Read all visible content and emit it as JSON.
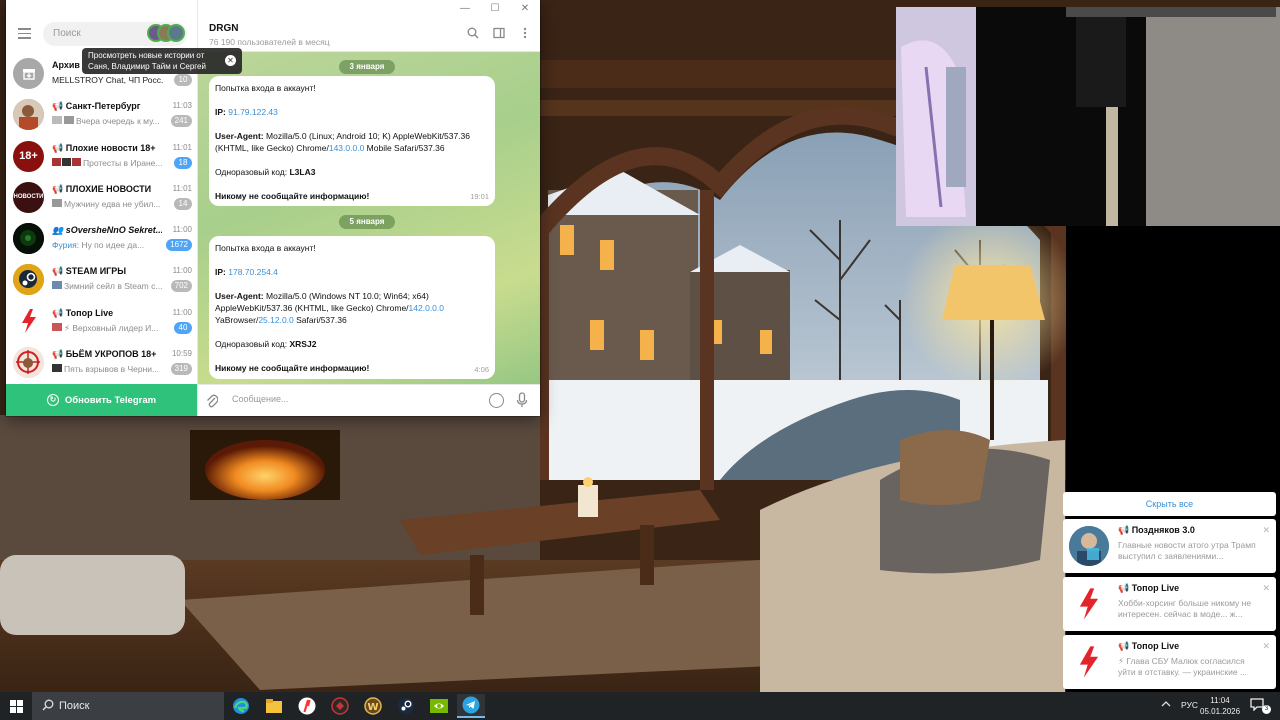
{
  "telegram": {
    "search_placeholder": "Поиск",
    "stories_tooltip_line1": "Просмотреть новые истории от",
    "stories_tooltip_line2": "Саня, Владимир Тайм и Сергей",
    "update_label": "Обновить Telegram",
    "chats": [
      {
        "name": "Архив",
        "time": "",
        "preview_who": "",
        "preview": "MELLSTROY Chat, ЧП Росс...",
        "badge": "10",
        "badge_style": "grey",
        "avatar_color": "#a8a8a8",
        "avatar_text": ""
      },
      {
        "name": "📢 Санкт-Петербург",
        "time": "11:03",
        "preview_who": "",
        "preview": "Вчера очередь к му...",
        "badge": "241",
        "badge_style": "grey",
        "avatar_color": "#b48a6a",
        "avatar_text": ""
      },
      {
        "name": "📢 Плохие новости 18+",
        "time": "11:01",
        "preview_who": "",
        "preview": "Протесты в Иране...",
        "badge": "18",
        "badge_style": "blue",
        "avatar_color": "#8a1010",
        "avatar_text": "18+"
      },
      {
        "name": "📢 ПЛОХИЕ НОВОСТИ",
        "time": "11:01",
        "preview_who": "",
        "preview": "Мужчину едва не убил...",
        "badge": "14",
        "badge_style": "grey",
        "avatar_color": "#3a1010",
        "avatar_text": "НОВОСТИ"
      },
      {
        "name": "👥 sOversheNnO Sekret...",
        "time": "11:00",
        "preview_who": "Фурия:",
        "preview": " Ну по идее да...",
        "badge": "1672",
        "badge_style": "blue",
        "avatar_color": "#0a1a0a",
        "avatar_text": ""
      },
      {
        "name": "📢 STEAM ИГРЫ",
        "time": "11:00",
        "preview_who": "",
        "preview": "Зимний сейл в Steam с...",
        "badge": "702",
        "badge_style": "grey",
        "avatar_color": "#d89a10",
        "avatar_text": ""
      },
      {
        "name": "📢 Топор Live",
        "time": "11:00",
        "preview_who": "",
        "preview": "⚡ Верховный лидер И...",
        "badge": "40",
        "badge_style": "blue",
        "avatar_color": "#ffffff",
        "avatar_text": ""
      },
      {
        "name": "📢 БЬЁМ УКРОПОВ 18+",
        "time": "10:59",
        "preview_who": "",
        "preview": "Пять взрывов в Черни...",
        "badge": "319",
        "badge_style": "grey",
        "avatar_color": "#f2e6e0",
        "avatar_text": ""
      }
    ],
    "chat_header": {
      "title": "DRGN",
      "subtitle": "76 190 пользователей в месяц"
    },
    "dates": [
      "3 января",
      "5 января"
    ],
    "messages": [
      {
        "intro": "Попытка входа в аккаунт!",
        "ip_label": "IP:",
        "ip": "91.79.122.43",
        "ua_label": "User-Agent:",
        "ua_1": " Mozilla/5.0 (Linux; Android 10; K) AppleWebKit/537.36",
        "ua_2": "(KHTML, like Gecko) Chrome/",
        "ua_ver": "143.0.0.0",
        "ua_3": " Mobile Safari/537.36",
        "ua_4": "",
        "ua_ver2": "",
        "ua_5": "",
        "code_label": "Одноразовый код:",
        "code": "L3LA3",
        "warning": "Никому не сообщайте информацию!",
        "time": "19:01"
      },
      {
        "intro": "Попытка входа в аккаунт!",
        "ip_label": "IP:",
        "ip": "178.70.254.4",
        "ua_label": "User-Agent:",
        "ua_1": " Mozilla/5.0 (Windows NT 10.0; Win64; x64)",
        "ua_2": "AppleWebKit/537.36 (KHTML, like Gecko) Chrome/",
        "ua_ver": "142.0.0.0",
        "ua_3": "",
        "ua_4": "YaBrowser/",
        "ua_ver2": "25.12.0.0",
        "ua_5": " Safari/537.36",
        "code_label": "Одноразовый код:",
        "code": "XRSJ2",
        "warning": "Никому не сообщайте информацию!",
        "time": "4:06"
      }
    ],
    "composer_placeholder": "Сообщение..."
  },
  "notifications": {
    "hide_all": "Скрыть все",
    "items": [
      {
        "title": "📢 Поздняков 3.0",
        "text": "Главные новости атого утра Трамп выступил с заявлениями...",
        "icon": "person-avatar"
      },
      {
        "title": "📢 Топор Live",
        "text": "Хобби-хорсинг больше никому не интересен. сейчас в моде... ж...",
        "icon": "lightning-icon"
      },
      {
        "title": "📢 Топор Live",
        "text": "⚡ Глава СБУ Малюк согласился уйти в отставку. — украинские ...",
        "icon": "lightning-icon"
      }
    ]
  },
  "taskbar": {
    "search_label": "Поиск",
    "apps": [
      "edge-icon",
      "file-explorer-icon",
      "yandex-browser-icon",
      "app-icon",
      "world-of-warcraft-icon",
      "steam-icon",
      "nvidia-icon",
      "telegram-icon"
    ],
    "language": "РУС",
    "time": "11:04",
    "date": "05.01.2026",
    "notification_count": "3"
  },
  "colors": {
    "telegram_green": "#2fc27a",
    "link_blue": "#3a8fd6",
    "badge_blue": "#4ea4f6",
    "taskbar": "#1f2326"
  }
}
